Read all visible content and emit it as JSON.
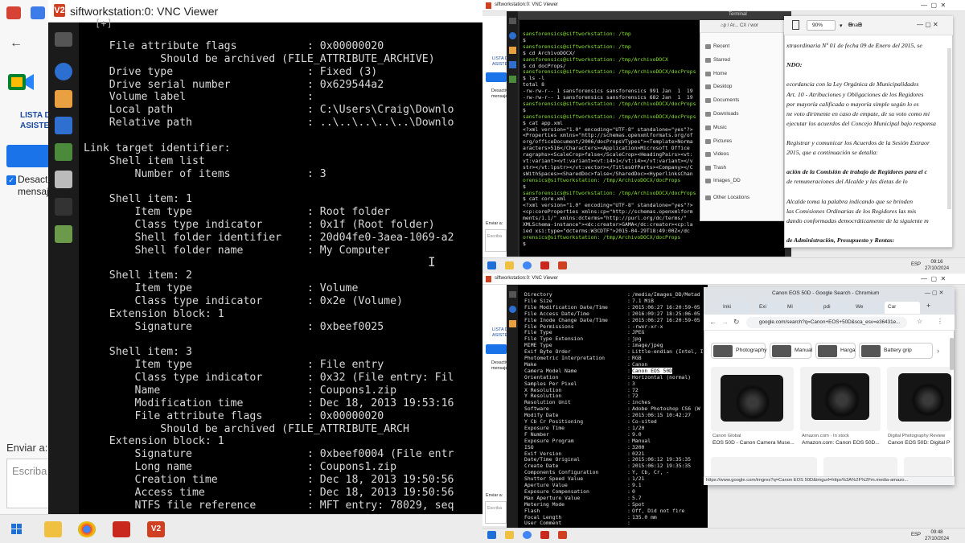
{
  "left": {
    "vnc_title": "siftworkstation:0: VNC Viewer",
    "vnc_logo": "V2",
    "chat": {
      "list_label_1": "LISTA DE",
      "list_label_2": "ASISTENTES",
      "deactivate_label_1": "Desactiv",
      "deactivate_label_2": "mensaje",
      "send_to_label": "Enviar a:",
      "write_placeholder": "Escriba a"
    },
    "terminal_lines": [
      "    File attribute flags           : 0x00000020",
      "            Should be archived (FILE_ATTRIBUTE_ARCHIVE)",
      "    Drive type                     : Fixed (3)",
      "    Drive serial number            : 0x629544a2",
      "    Volume label                   :",
      "    Local path                     : C:\\Users\\Craig\\Downlo",
      "    Relative path                  : ..\\..\\..\\..\\..\\Downlo",
      "",
      "Link target identifier:",
      "    Shell item list",
      "        Number of items            : 3",
      "",
      "    Shell item: 1",
      "        Item type                  : Root folder",
      "        Class type indicator       : 0x1f (Root folder)",
      "        Shell folder identifier    : 20d04fe0-3aea-1069-a2",
      "        Shell folder name          : My Computer",
      "",
      "    Shell item: 2",
      "        Item type                  : Volume",
      "        Class type indicator       : 0x2e (Volume)",
      "    Extension block: 1",
      "        Signature                  : 0xbeef0025",
      "",
      "    Shell item: 3",
      "        Item type                  : File entry",
      "        Class type indicator       : 0x32 (File entry: Fil",
      "        Name                       : Coupons1.zip",
      "        Modification time          : Dec 18, 2013 19:53:16",
      "        File attribute flags       : 0x00000020",
      "            Should be archived (FILE_ATTRIBUTE_ARCH",
      "    Extension block: 1",
      "        Signature                  : 0xbeef0004 (File entr",
      "        Long name                  : Coupons1.zip",
      "        Creation time              : Dec 18, 2013 19:50:56",
      "        Access time                : Dec 18, 2013 19:50:56",
      "        NTFS file reference        : MFT entry: 78029, seq"
    ],
    "term_cursor": "I",
    "term_tab": "[+]"
  },
  "top_right": {
    "vnc_title": "siftworkstation:0: VNC Viewer",
    "terminal_title": "Terminal",
    "terminal_lines": [
      "sansforensics@siftworkstation: /tmp",
      "$ ",
      "sansforensics@siftworkstation: /tmp",
      "$ cd ArchivoDOCX/",
      "sansforensics@siftworkstation: /tmp/ArchivoDOCX",
      "$ cd docProps/",
      "sansforensics@siftworkstation: /tmp/ArchivoDOCX/docProps",
      "$ ls -l",
      "total 8",
      "-rw-rw-r-- 1 sansforensics sansforensics 991 Jan  1  19",
      "-rw-rw-r-- 1 sansforensics sansforensics 682 Jan  1  19",
      "sansforensics@siftworkstation: /tmp/ArchivoDOCX/docProps",
      "$ ",
      "sansforensics@siftworkstation: /tmp/ArchivoDOCX/docProps",
      "$ cat app.xml",
      "<?xml version=\"1.0\" encoding=\"UTF-8\" standalone=\"yes\"?>",
      "<Properties xmlns=\"http://schemas.openxmlformats.org/of",
      "org/officeDocument/2006/docPropsVTypes\"><Template>Norma",
      "aracters>516</Characters><Application>Microsoft Office",
      "ragraphs><ScaleCrop>false</ScaleCrop><HeadingPairs><vt:",
      "vt:variant><vt:variant><vt:i4>1</vt:i4></vt:variant></v",
      "str></vt:lpstr></vt:vector></TitlesOfParts><Company></C",
      "sWithSpaces><SharedDoc>false</SharedDoc><HyperlinksChan",
      "orensics@siftworkstation: /tmp/ArchivoDOCX/docProps",
      "$ ",
      "sansforensics@siftworkstation: /tmp/ArchivoDOCX/docProps",
      "$ cat core.xml",
      "<?xml version=\"1.0\" encoding=\"UTF-8\" standalone=\"yes\"?>",
      "<cp:coreProperties xmlns:cp=\"http://schemas.openxmlform",
      "ments/1.1/\" xmlns:dcterms=\"http://purl.org/dc/terms/\"",
      "XMLSchema-instance\"><dc:creator>GAMA</dc:creator><cp:la",
      "ied xsi:type=\"dcterms:W3CDTF\">2015-04-29T18:49:00Z</dc",
      "orensics@siftworkstation: /tmp/ArchivoDOCX/docProps",
      "$ "
    ],
    "files": {
      "path": "⌂p / Ar... CX / wor",
      "items": [
        "Recent",
        "Starred",
        "Home",
        "Desktop",
        "Documents",
        "Downloads",
        "Music",
        "Pictures",
        "Videos",
        "Trash",
        "Images_DD",
        "Other Locations"
      ]
    },
    "doc": {
      "zoom": "90%",
      "tab": "Ima...",
      "lines": [
        "xtraordinaria  Nº 01  de  fecha  09  de Enero del 2015, se",
        "",
        "NDO:",
        "",
        "ecordancia  con  la  Ley  Orgánica  de  Municipalidades",
        "Art. 10 - Atribuciones y Obligaciones de los Regidores",
        "por mayoría  calificada o mayoría  simple según lo es",
        "ne voto dirimente en caso de empate, de su voto como mi",
        "ejecutar los acuerdos del Concejo Municipal  bajo responsa",
        "",
        "Registrar y comunicar los Acuerdos de la Sesión Extraor",
        "2015, que a continuación  se  detalla:",
        "",
        "ación de la Comisión de trabajo de Regidores para el c",
        "de remuneraciones del Alcalde y las dietas de lo",
        "",
        "Alcalde  toma  la  palabra  indicando  que  se  brinden",
        "las Comisiones Ordinarias de los Regidores las mis",
        "dando conformadas democráticamente de la siguiente m",
        "",
        "de Administración, Presupuesto y Rentas:"
      ]
    },
    "clock_time": "09:16",
    "clock_date": "27/10/2024",
    "lang": "ESP"
  },
  "bottom_right": {
    "vnc_title": "siftworkstation:0: VNC Viewer",
    "exif": [
      [
        "Directory",
        "/media/Images_DD/Metad"
      ],
      [
        "File Size",
        "7.1 MiB"
      ],
      [
        "File Modification Date/Time",
        "2015:06:27 16:20:59-05"
      ],
      [
        "File Access Date/Time",
        "2016:09:27 18:25:06-05"
      ],
      [
        "File Inode Change Date/Time",
        "2015:06:27 16:20:59-05"
      ],
      [
        "File Permissions",
        "-rwxr-xr-x"
      ],
      [
        "File Type",
        "JPEG"
      ],
      [
        "File Type Extension",
        "jpg"
      ],
      [
        "MIME Type",
        "image/jpeg"
      ],
      [
        "Exif Byte Order",
        "Little-endian (Intel, I"
      ],
      [
        "Photometric Interpretation",
        "RGB"
      ],
      [
        "Make",
        "Canon"
      ],
      [
        "Camera Model Name",
        "Canon EOS 50D"
      ],
      [
        "Orientation",
        "Horizontal (normal)"
      ],
      [
        "Samples Per Pixel",
        "3"
      ],
      [
        "X Resolution",
        "72"
      ],
      [
        "Y Resolution",
        "72"
      ],
      [
        "Resolution Unit",
        "inches"
      ],
      [
        "Software",
        "Adobe Photoshop CS6 (W"
      ],
      [
        "Modify Date",
        "2015:06:15 10:42:27"
      ],
      [
        "Y Cb Cr Positioning",
        "Co-sited"
      ],
      [
        "Exposure Time",
        "1/20"
      ],
      [
        "F Number",
        "9.0"
      ],
      [
        "Exposure Program",
        "Manual"
      ],
      [
        "ISO",
        "3200"
      ],
      [
        "Exif Version",
        "0221"
      ],
      [
        "Date/Time Original",
        "2015:06:12 19:35:35"
      ],
      [
        "Create Date",
        "2015:06:12 19:35:35"
      ],
      [
        "Components Configuration",
        "Y, Cb, Cr, -"
      ],
      [
        "Shutter Speed Value",
        "1/21"
      ],
      [
        "Aperture Value",
        "9.1"
      ],
      [
        "Exposure Compensation",
        "0"
      ],
      [
        "Max Aperture Value",
        "5.7"
      ],
      [
        "Metering Mode",
        "Spot"
      ],
      [
        "Flash",
        "Off, Did not fire"
      ],
      [
        "Focal Length",
        "135.0 mm"
      ],
      [
        "User Comment",
        ""
      ]
    ],
    "chrome": {
      "title": "Canon EOS 50D - Google Search - Chromium",
      "tabs": [
        "Inki",
        "Exi",
        "Mi",
        "pdi",
        "We",
        "Car"
      ],
      "url": "google.com/search?q=Canon+EOS+50D&sca_esv=e36431e...",
      "chips": [
        "Photography",
        "Manual",
        "Harga",
        "Battery grip"
      ],
      "results": [
        {
          "source": "Canon Global",
          "caption": "EOS 50D - Canon Camera Muse..."
        },
        {
          "source": "Amazon.com · In stock",
          "caption": "Amazon.com: Canon EOS 50D..."
        },
        {
          "source": "Digital Photography Review",
          "caption": "Canon EOS 50D: Digital P"
        }
      ],
      "status_url": "https://www.google.com/imgres?q=Canon EOS 50D&imgurl=https%3A%2F%2Fm.media-amazo..."
    },
    "clock_time": "09:48",
    "clock_date": "27/10/2024",
    "lang": "ESP"
  },
  "mini_chat": {
    "list": "LISTA DE",
    "asist": "ASISTENTES",
    "deact": "Desactiv",
    "mensaje": "mensaje",
    "enviar": "Enviar a:",
    "escriba": "Escriba"
  },
  "colors": {
    "terminal_bg": "#000000",
    "prompt_user": "#8ae234",
    "prompt_path": "#729fcf",
    "vnc_red": "#d04020",
    "chrome_blue": "#1a73e8"
  }
}
